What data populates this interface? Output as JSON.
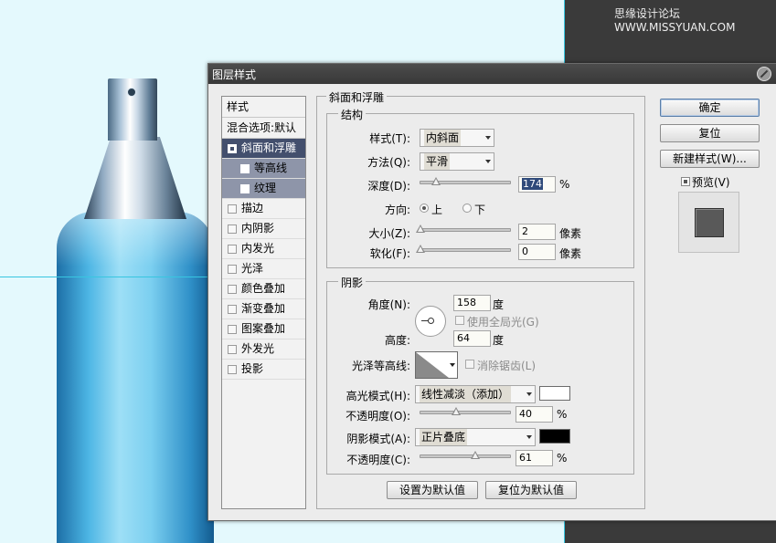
{
  "watermark": "思缘设计论坛 WWW.MISSYUAN.COM",
  "dialog": {
    "title": "图层样式",
    "styles_header": "样式",
    "blend_options": "混合选项:默认",
    "styles": [
      {
        "label": "斜面和浮雕"
      },
      {
        "label": "等高线"
      },
      {
        "label": "纹理"
      },
      {
        "label": "描边"
      },
      {
        "label": "内阴影"
      },
      {
        "label": "内发光"
      },
      {
        "label": "光泽"
      },
      {
        "label": "颜色叠加"
      },
      {
        "label": "渐变叠加"
      },
      {
        "label": "图案叠加"
      },
      {
        "label": "外发光"
      },
      {
        "label": "投影"
      }
    ],
    "buttons": {
      "ok": "确定",
      "reset": "复位",
      "new_style": "新建样式(W)...",
      "preview": "预览(V)"
    },
    "bevel": {
      "section_title": "斜面和浮雕",
      "structure_title": "结构",
      "style_label": "样式(T):",
      "style_value": "内斜面",
      "technique_label": "方法(Q):",
      "technique_value": "平滑",
      "depth_label": "深度(D):",
      "depth_value": "174",
      "depth_slider": 0.17,
      "percent": "%",
      "direction_label": "方向:",
      "dir_up": "上",
      "dir_down": "下",
      "size_label": "大小(Z):",
      "size_value": "2",
      "size_slider": 0.0,
      "pixels": "像素",
      "soften_label": "软化(F):",
      "soften_value": "0",
      "soften_slider": 0.0
    },
    "shading": {
      "title": "阴影",
      "angle_label": "角度(N):",
      "angle_value": "158",
      "degree": "度",
      "global_light": "使用全局光(G)",
      "altitude_label": "高度:",
      "altitude_value": "64",
      "gloss_contour_label": "光泽等高线:",
      "anti_aliased": "消除锯齿(L)",
      "highlight_mode_label": "高光模式(H):",
      "highlight_mode_value": "线性减淡（添加）",
      "highlight_color": "#ffffff",
      "highlight_opacity_label": "不透明度(O):",
      "highlight_opacity_value": "40",
      "highlight_opacity_slider": 0.4,
      "shadow_mode_label": "阴影模式(A):",
      "shadow_mode_value": "正片叠底",
      "shadow_color": "#000000",
      "shadow_opacity_label": "不透明度(C):",
      "shadow_opacity_value": "61",
      "shadow_opacity_slider": 0.61
    },
    "bottom_buttons": {
      "make_default": "设置为默认值",
      "reset_default": "复位为默认值"
    }
  }
}
